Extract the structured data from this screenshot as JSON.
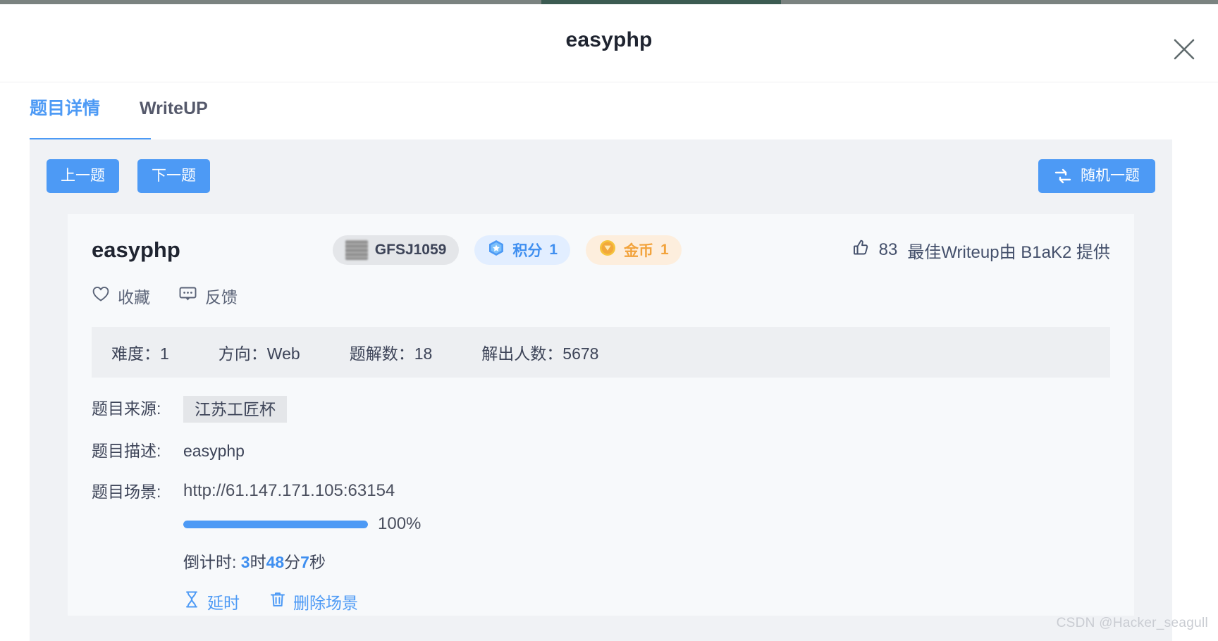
{
  "modal": {
    "title": "easyphp",
    "close_icon": "close-icon"
  },
  "tabs": [
    {
      "label": "题目详情",
      "active": true
    },
    {
      "label": "WriteUP",
      "active": false
    }
  ],
  "toolbar": {
    "prev_label": "上一题",
    "next_label": "下一题",
    "random_label": "随机一题",
    "random_icon": "shuffle-icon"
  },
  "challenge": {
    "title": "easyphp",
    "badges": [
      {
        "name": "id",
        "icon": "blurred-avatar-icon",
        "label": "GFSJ1059",
        "value": ""
      },
      {
        "name": "score",
        "icon": "gem-star-icon",
        "label": "积分",
        "value": "1"
      },
      {
        "name": "coin",
        "icon": "gold-coin-icon",
        "label": "金币",
        "value": "1"
      }
    ],
    "likes_icon": "thumbs-up-icon",
    "likes_count": "83",
    "best_writeup": "最佳Writeup由 B1aK2 提供"
  },
  "meta_actions": [
    {
      "icon": "heart-icon",
      "label": "收藏"
    },
    {
      "icon": "comment-icon",
      "label": "反馈"
    }
  ],
  "info": [
    {
      "label": "难度：",
      "value": "1"
    },
    {
      "label": "方向：",
      "value": "Web"
    },
    {
      "label": "题解数：",
      "value": "18"
    },
    {
      "label": "解出人数：",
      "value": "5678"
    }
  ],
  "details": {
    "source_label": "题目来源:",
    "source_value": "江苏工匠杯",
    "description_label": "题目描述:",
    "description_value": "easyphp",
    "scene_label": "题目场景:",
    "scene_url": "http://61.147.171.105:63154",
    "progress_percent": 100,
    "progress_text": "100%",
    "countdown_prefix": "倒计时:",
    "countdown_hours": "3",
    "countdown_hours_unit": "时",
    "countdown_minutes": "48",
    "countdown_minutes_unit": "分",
    "countdown_seconds": "7",
    "countdown_seconds_unit": "秒",
    "actions": [
      {
        "icon": "hourglass-icon",
        "label": "延时"
      },
      {
        "icon": "trash-icon",
        "label": "删除场景"
      }
    ]
  },
  "watermark": "CSDN @Hacker_seagull",
  "colors": {
    "accent": "#4d9af5",
    "panel_bg": "#f0f2f5",
    "card_bg": "#f7f9fb",
    "text": "#3d4458"
  }
}
